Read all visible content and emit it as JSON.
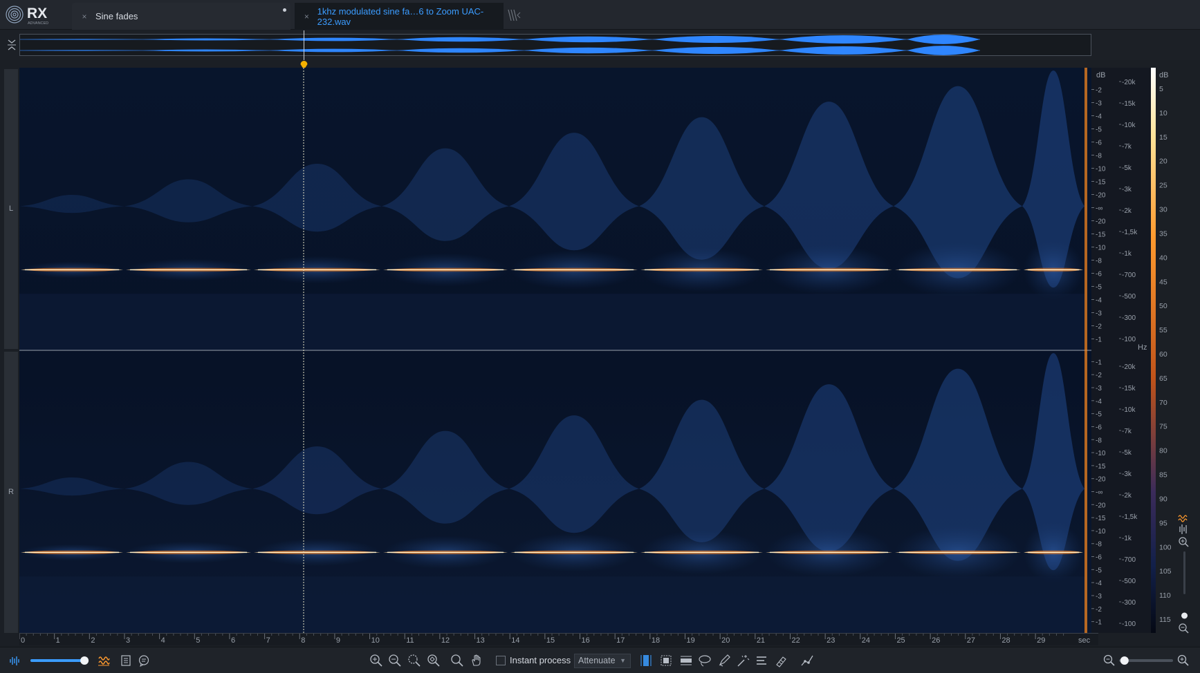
{
  "app": {
    "name": "RX",
    "edition": "ADVANCED"
  },
  "tabs": [
    {
      "label": "Sine fades",
      "close": "×",
      "active": false,
      "modified": true
    },
    {
      "label": "1khz modulated sine fa…6 to Zoom UAC-232.wav",
      "close": "×",
      "active": true
    }
  ],
  "channels": {
    "left": "L",
    "right": "R"
  },
  "db_scale_label": "dB",
  "hz_scale_label": "Hz",
  "amp_scale_ticks_top": [
    "-2",
    "-3",
    "-4",
    "-5",
    "-6",
    "-8",
    "-10",
    "-15",
    "-20",
    "-∞",
    "-20",
    "-15",
    "-10",
    "-8",
    "-6",
    "-5",
    "-4",
    "-3",
    "-2",
    "-1"
  ],
  "amp_scale_ticks_bottom": [
    "-1",
    "-2",
    "-3",
    "-4",
    "-5",
    "-6",
    "-8",
    "-10",
    "-15",
    "-20",
    "-∞",
    "-20",
    "-15",
    "-10",
    "-8",
    "-6",
    "-5",
    "-4",
    "-3",
    "-2",
    "-1"
  ],
  "freq_ticks": [
    "-20k",
    "-15k",
    "-10k",
    "-7k",
    "-5k",
    "-3k",
    "-2k",
    "-1,5k",
    "-1k",
    "-700",
    "-500",
    "-300",
    "-100"
  ],
  "color_scale_ticks": [
    "5",
    "10",
    "15",
    "20",
    "25",
    "30",
    "35",
    "40",
    "45",
    "50",
    "55",
    "60",
    "65",
    "70",
    "75",
    "80",
    "85",
    "90",
    "95",
    "100",
    "105",
    "110",
    "115"
  ],
  "time_ticks": [
    "0",
    "1",
    "2",
    "3",
    "4",
    "5",
    "6",
    "7",
    "8",
    "9",
    "10",
    "11",
    "12",
    "13",
    "14",
    "15",
    "16",
    "17",
    "18",
    "19",
    "20",
    "21",
    "22",
    "23",
    "24",
    "25",
    "26",
    "27",
    "28",
    "29"
  ],
  "time_unit": "sec",
  "bottom": {
    "instant_process_label": "Instant process",
    "instant_process_checked": false,
    "mode_value": "Attenuate",
    "opacity_level": 0.93,
    "zoom_level": 0.1
  },
  "colors": {
    "accent": "#3b9cff",
    "cursor_marker": "#f5b100",
    "sine": "#ff9a2e"
  }
}
